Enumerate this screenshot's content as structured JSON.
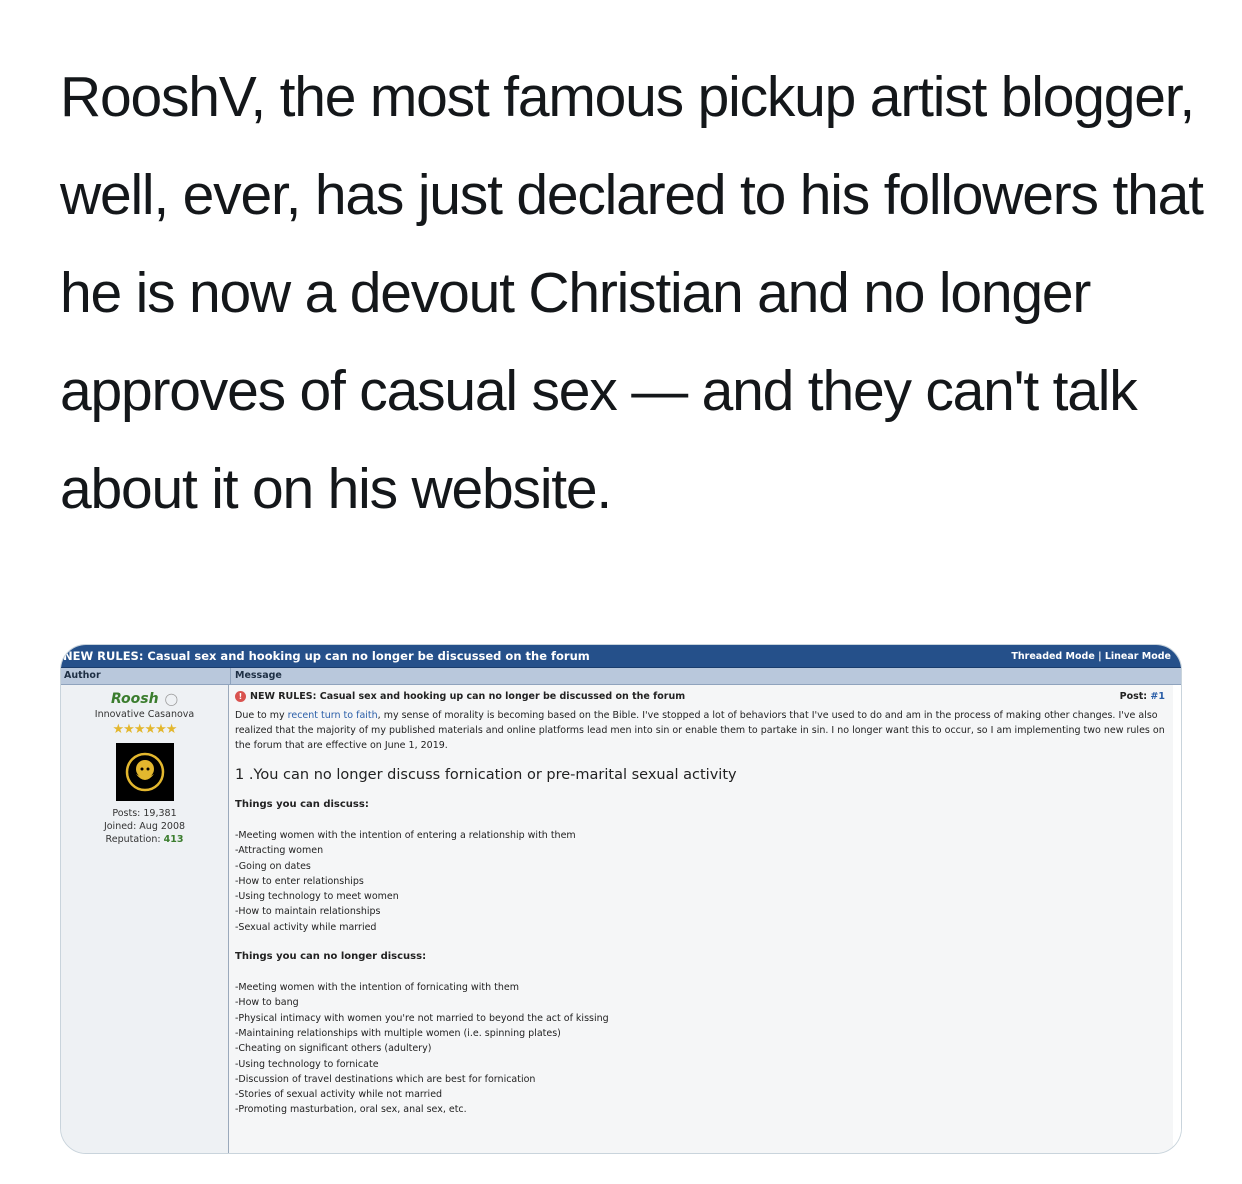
{
  "tweet": {
    "text": "RooshV, the most famous pickup artist blogger, well, ever, has just declared to his followers that he is now a devout Christian and no longer approves of casual sex — and they can't talk about it on his website."
  },
  "forum": {
    "thread_title": "NEW RULES: Casual sex and hooking up can no longer be discussed on the forum",
    "modes": "Threaded Mode | Linear Mode",
    "col_author": "Author",
    "col_message": "Message",
    "author": {
      "name": "Roosh",
      "title": "Innovative Casanova",
      "stars": "★★★★★★",
      "posts": "Posts: 19,381",
      "joined": "Joined: Aug 2008",
      "reputation_label": "Reputation:",
      "reputation_value": "413"
    },
    "post": {
      "title": "NEW RULES: Casual sex and hooking up can no longer be discussed on the forum",
      "post_label": "Post:",
      "post_number": "#1",
      "intro_a": "Due to my ",
      "intro_link": "recent turn to faith",
      "intro_b": ", my sense of morality is becoming based on the Bible. I've stopped a lot of behaviors that I've used to do and am in the process of making other changes. I've also realized that the majority of my published materials and online platforms lead men into sin or enable them to partake in sin. I no longer want this to occur, so I am implementing two new rules on the forum that are effective on June 1, 2019.",
      "rule1": "1 .You can no longer discuss fornication or pre-marital sexual activity",
      "can_heading": "Things you can discuss:",
      "can_items": [
        "-Meeting women with the intention of entering a relationship with them",
        "-Attracting women",
        "-Going on dates",
        "-How to enter relationships",
        "-Using technology to meet women",
        "-How to maintain relationships",
        "-Sexual activity while married"
      ],
      "cannot_heading": "Things you can no longer discuss:",
      "cannot_items": [
        "-Meeting women with the intention of fornicating with them",
        "-How to bang",
        "-Physical intimacy with women you're not married to beyond the act of kissing",
        "-Maintaining relationships with multiple women (i.e. spinning plates)",
        "-Cheating on significant others (adultery)",
        "-Using technology to fornicate",
        "-Discussion of travel destinations which are best for fornication",
        "-Stories of sexual activity while not married",
        "-Promoting masturbation, oral sex, anal sex, etc."
      ]
    }
  }
}
